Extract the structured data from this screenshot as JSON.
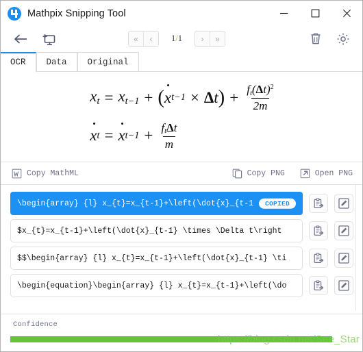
{
  "window": {
    "title": "Mathpix Snipping Tool",
    "logo_icon": "mathpix-logo-icon",
    "controls": {
      "minimize": "minimize-icon",
      "maximize": "maximize-icon",
      "close": "close-icon"
    }
  },
  "toolbar": {
    "back_icon": "back-arrow-icon",
    "new_snip_icon": "new-snip-icon",
    "delete_icon": "trash-icon",
    "settings_icon": "gear-icon",
    "pager": {
      "first_label": "«",
      "prev_label": "‹",
      "next_label": "›",
      "last_label": "»",
      "current": "1",
      "separator": "/",
      "total": "1"
    }
  },
  "tabs": [
    {
      "label": "OCR",
      "active": true
    },
    {
      "label": "Data",
      "active": false
    },
    {
      "label": "Original",
      "active": false
    }
  ],
  "equations": {
    "line1": "x_t = x_{t-1} + (\\dot{x}_{t-1} \\times \\Delta t) + \\frac{f_t(\\Delta t)^2}{2m}",
    "line2": "\\dot{x}_t = \\dot{x}_{t-1} + \\frac{f_t \\Delta t}{m}",
    "glyphs": {
      "x": "x",
      "eq": "=",
      "plus": "+",
      "times": "×",
      "delta": "Δ",
      "t": "t",
      "f": "f",
      "m": "m",
      "sub_t": "t",
      "sub_tm1": "t-1",
      "two_m": "2m",
      "sup_2": "2",
      "lparen": "(",
      "rparen": ")"
    }
  },
  "copybar": {
    "mathml": {
      "label": "Copy MathML",
      "icon": "word-document-icon"
    },
    "copy_png": {
      "label": "Copy PNG",
      "icon": "copy-pages-icon"
    },
    "open_png": {
      "label": "Open PNG",
      "icon": "open-external-icon"
    }
  },
  "results": [
    {
      "text": "\\begin{array} {l}  x_{t}=x_{t-1}+\\left(\\dot{x}_{t-1",
      "selected": true,
      "badge": "COPIED",
      "copy_icon": "clipboard-paste-icon",
      "edit_icon": "edit-square-icon"
    },
    {
      "text": "$x_{t}=x_{t-1}+\\left(\\dot{x}_{t-1} \\times \\Delta t\\right",
      "selected": false,
      "badge": "",
      "copy_icon": "clipboard-paste-icon",
      "edit_icon": "edit-square-icon"
    },
    {
      "text": "$$\\begin{array} {l}  x_{t}=x_{t-1}+\\left(\\dot{x}_{t-1} \\ti",
      "selected": false,
      "badge": "",
      "copy_icon": "clipboard-paste-icon",
      "edit_icon": "edit-square-icon"
    },
    {
      "text": "\\begin{equation}\\begin{array} {l}  x_{t}=x_{t-1}+\\left(\\do",
      "selected": false,
      "badge": "",
      "copy_icon": "clipboard-paste-icon",
      "edit_icon": "edit-square-icon"
    }
  ],
  "confidence": {
    "label": "Confidence",
    "percent": 92,
    "bar_color": "#62c637"
  },
  "watermark": {
    "text": "https://blog.csdn.net/See_Star"
  }
}
